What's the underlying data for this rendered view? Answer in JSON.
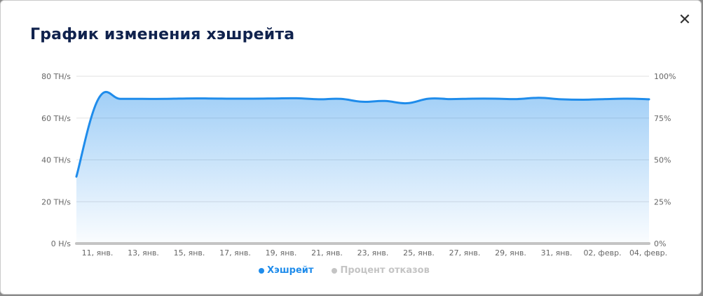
{
  "modal": {
    "title": "График изменения хэшрейта",
    "close_label": "✕"
  },
  "colors": {
    "hashrate": "#1f8ceb",
    "reject": "#c4c4c4",
    "grid": "#e2e2e2",
    "axis_text": "#666666",
    "title": "#10224d"
  },
  "chart_data": {
    "type": "line",
    "y_left_ticks": [
      "0 H/s",
      "20 TH/s",
      "40 TH/s",
      "60 TH/s",
      "80 TH/s"
    ],
    "y_right_ticks": [
      "0%",
      "25%",
      "50%",
      "75%",
      "100%"
    ],
    "ylim_left": [
      0,
      80
    ],
    "ylim_right": [
      0,
      100
    ],
    "x_tick_labels": [
      "11, янв.",
      "13, янв.",
      "15, янв.",
      "17, янв.",
      "19, янв.",
      "21, янв.",
      "23, янв.",
      "25, янв.",
      "27, янв.",
      "29, янв.",
      "31, янв.",
      "02, февр.",
      "04, февр."
    ],
    "x": [
      "10, янв.",
      "11, янв.",
      "12, янв.",
      "13, янв.",
      "14, янв.",
      "15, янв.",
      "16, янв.",
      "17, янв.",
      "18, янв.",
      "19, янв.",
      "20, янв.",
      "21, янв.",
      "22, янв.",
      "23, янв.",
      "24, янв.",
      "25, янв.",
      "26, янв.",
      "27, янв.",
      "28, янв.",
      "29, янв.",
      "30, янв.",
      "31, янв.",
      "01, февр.",
      "02, февр.",
      "03, февр.",
      "04, февр.",
      "05, февр."
    ],
    "series": [
      {
        "name": "Хэшрейт",
        "axis": "left",
        "values": [
          32,
          69.2,
          69.2,
          69.2,
          69.2,
          69.4,
          69.4,
          69.3,
          69.3,
          69.4,
          69.5,
          69.0,
          69.2,
          67.8,
          68.2,
          67.1,
          69.3,
          69.1,
          69.3,
          69.3,
          69.1,
          69.7,
          69.0,
          68.8,
          69.1,
          69.3,
          69.0
        ]
      },
      {
        "name": "Процент отказов",
        "axis": "right",
        "values": [
          0,
          0,
          0,
          0,
          0,
          0,
          0,
          0,
          0,
          0,
          0,
          0,
          0,
          0,
          0,
          0,
          0,
          0,
          0,
          0,
          0,
          0,
          0,
          0,
          0,
          0,
          0
        ]
      }
    ],
    "grid": true,
    "legend_position": "bottom-center"
  }
}
